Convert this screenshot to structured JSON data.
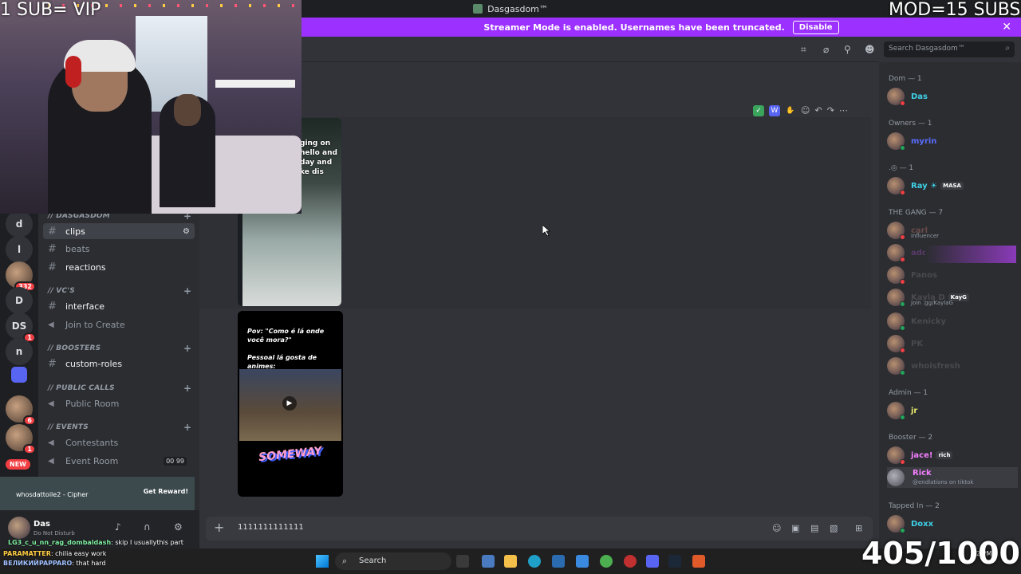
{
  "window": {
    "title": "Dasgasdom™"
  },
  "banner": {
    "text": "Streamer Mode is enabled. Usernames have been truncated.",
    "disable_label": "Disable",
    "close_glyph": "✕"
  },
  "overlays": {
    "sub_text": "1 SUB= VIP",
    "mod_text": "MOD=15 SUBS",
    "goal_text": "405/1000"
  },
  "rail": {
    "servers": [
      "d",
      "l",
      "D",
      "DS",
      "n"
    ],
    "badges": {
      "avatar_badge": "332",
      "ds_badge": "1",
      "bottom1": "6",
      "bottom2": "1"
    },
    "new_label": "NEW"
  },
  "sidebar": {
    "categories": {
      "dasgasdom": "// DASGASDOM",
      "vcs": "// Vc's",
      "boosters": "// Boosters",
      "public_calls": "// PUBLIC CALLS",
      "events": "// Events"
    },
    "channels": {
      "clips": "clips",
      "beats": "beats",
      "reactions": "reactions",
      "interface": "interface",
      "join_to_create": "Join to Create",
      "custom_roles": "custom-roles",
      "public_room": "Public Room",
      "contestants": "Contestants",
      "event_room": "Event Room",
      "event_room_count_a": "00",
      "event_room_count_b": "99"
    }
  },
  "reward": {
    "user": "whosdattoile2 - Cipher",
    "button": "Get Reward!"
  },
  "user_panel": {
    "name": "Das",
    "status": "Do Not Disturb"
  },
  "chat_overlay": {
    "line1_user": "LG3_c_u_nn_rag_dombaldash",
    "line1_text": ": skip I usuallythis part",
    "line2_user": "PARAMATTER",
    "line2_text": ": chilia easy work",
    "line3_user": "ВЕЛИКИЙPAPPARO",
    "line3_text": ": that hard"
  },
  "header": {
    "search_placeholder": "Search Dasgasdom™"
  },
  "messages": {
    "media2_caption": "ging on\nhello and\nday and\nke dis",
    "media3_caption": "Pov: \"Como é lá onde você mora?\"\n\nPessoal lá gosta de animes:",
    "media3_logo": "SOMEWAY"
  },
  "composer": {
    "text": "1111111111111"
  },
  "members": {
    "groups": {
      "dom": "Dom — 1",
      "owners": "Owners — 1",
      "dot": ".◎ — 1",
      "gang": "THE GANG — 7",
      "admin": "Admin — 1",
      "booster": "Booster — 2",
      "tapped": "Tapped In — 2"
    },
    "list": {
      "das": "Das",
      "myrin": "myrin",
      "ray": "Ray ☀",
      "ray_tag": "MASA",
      "carl": "carl",
      "carl_sub": "influencer",
      "ado": "ado",
      "fanos": "Fanos",
      "kayla": "Kayla D",
      "kayla_tag": "KayG",
      "kayla_sub": "Join .gg/KaylaG",
      "kenicky": "Kenicky",
      "pk": "PK",
      "whoisfresh": "whoisfresh",
      "jr": "jr",
      "jace": "jace!",
      "jace_tag": "rich",
      "rick": "Rick",
      "rick_sub": "@endlations on tiktok",
      "doxx": "Doxx"
    }
  },
  "taskbar": {
    "search_label": "Search",
    "clock": "2 PM"
  },
  "colors": {
    "accent": "#5865f2",
    "streamer_banner": "#9b30ff",
    "online": "#23a55a",
    "dnd": "#f23f43"
  }
}
